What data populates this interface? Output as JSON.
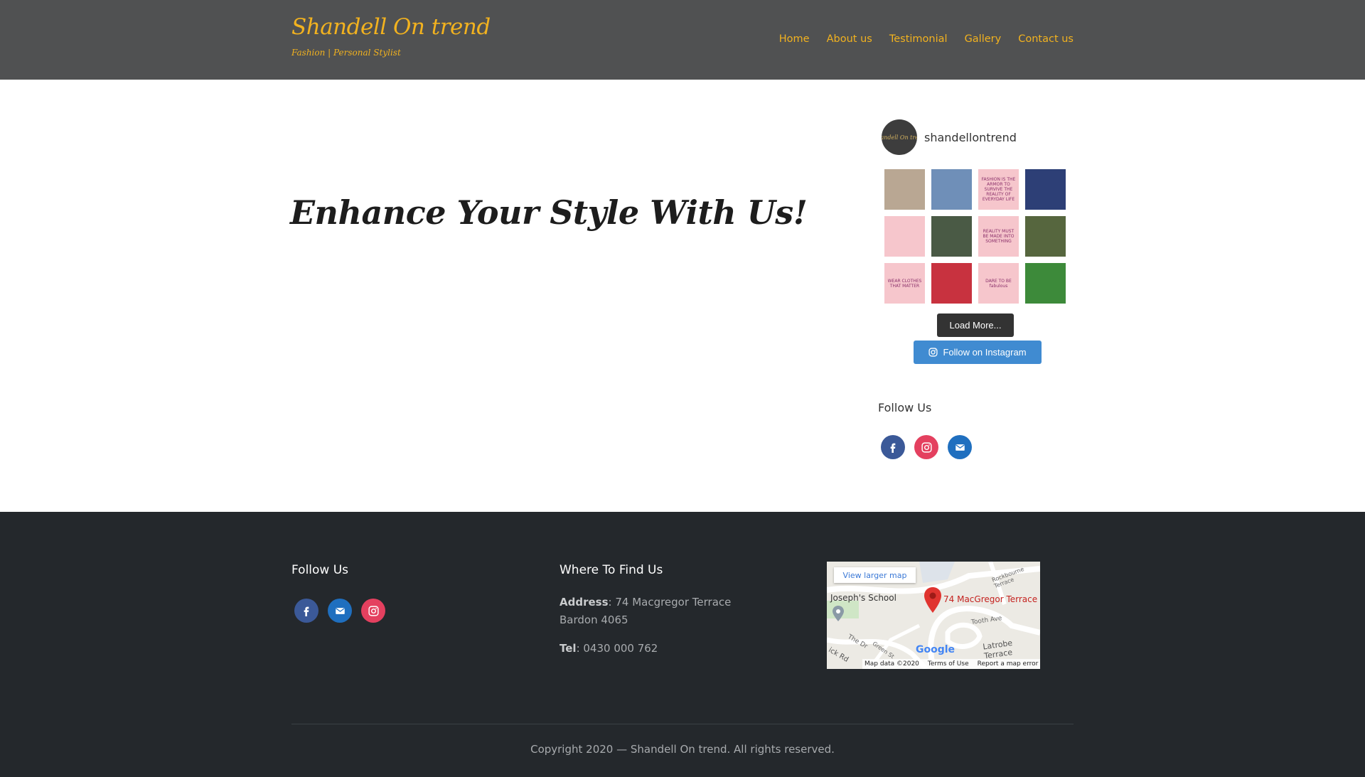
{
  "header": {
    "brand_title": "Shandell On trend",
    "brand_tagline": "Fashion | Personal Stylist",
    "nav": [
      "Home",
      "About us",
      "Testimonial",
      "Gallery",
      "Contact us"
    ]
  },
  "hero": {
    "title": "Enhance Your Style With Us!"
  },
  "instagram": {
    "avatar_text": "Shandell On trend",
    "username": "shandellontrend",
    "thumbs": [
      {
        "text": "",
        "color": "#b9a793"
      },
      {
        "text": "",
        "color": "#6f8fb8"
      },
      {
        "text": "FASHION IS THE ARMOR TO SURVIVE THE REALITY OF EVERYDAY LIFE",
        "color": "#f6c6cc"
      },
      {
        "text": "",
        "color": "#2d3f76"
      },
      {
        "text": "",
        "color": "#f6c6cc"
      },
      {
        "text": "",
        "color": "#4a5a45"
      },
      {
        "text": "REALITY MUST BE MADE INTO SOMETHING",
        "color": "#f6c6cc"
      },
      {
        "text": "",
        "color": "#56663e"
      },
      {
        "text": "WEAR CLOTHES THAT MATTER",
        "color": "#f6c6cc"
      },
      {
        "text": "",
        "color": "#c8323f"
      },
      {
        "text": "DARE TO BE fabulous",
        "color": "#f6c6cc"
      },
      {
        "text": "",
        "color": "#3d8a3a"
      }
    ],
    "load_more": "Load More...",
    "follow": "Follow on Instagram"
  },
  "sidebar": {
    "follow_title": "Follow Us"
  },
  "footer": {
    "follow_title": "Follow Us",
    "find_title": "Where To Find Us",
    "address_label": "Address",
    "address_line1": ": 74 Macgregor Terrace",
    "address_line2": "Bardon 4065",
    "tel_label": "Tel",
    "tel_value": ": 0430 000 762",
    "copyright": "Copyright 2020 — Shandell On trend. All rights reserved."
  },
  "map": {
    "view_larger": "View larger map",
    "pin_label": "74 MacGregor Terrace",
    "school_label": "Joseph's School",
    "street_1": "Rockbourne Terrace",
    "street_2": "Tooth Ave",
    "street_3": "Latrobe Terrace",
    "street_4": "The Dr",
    "street_5": "Green St",
    "street_6": "ick Rd",
    "google": "Google",
    "map_data": "Map data ©2020",
    "terms": "Terms of Use",
    "report": "Report a map error"
  },
  "colors": {
    "header_bg": "#505152",
    "accent": "#f2b21f",
    "footer_bg": "#24282c",
    "facebook": "#3b5998",
    "instagram": "#e4405f",
    "email": "#1f6fbf",
    "ig_button": "#408bd1"
  }
}
